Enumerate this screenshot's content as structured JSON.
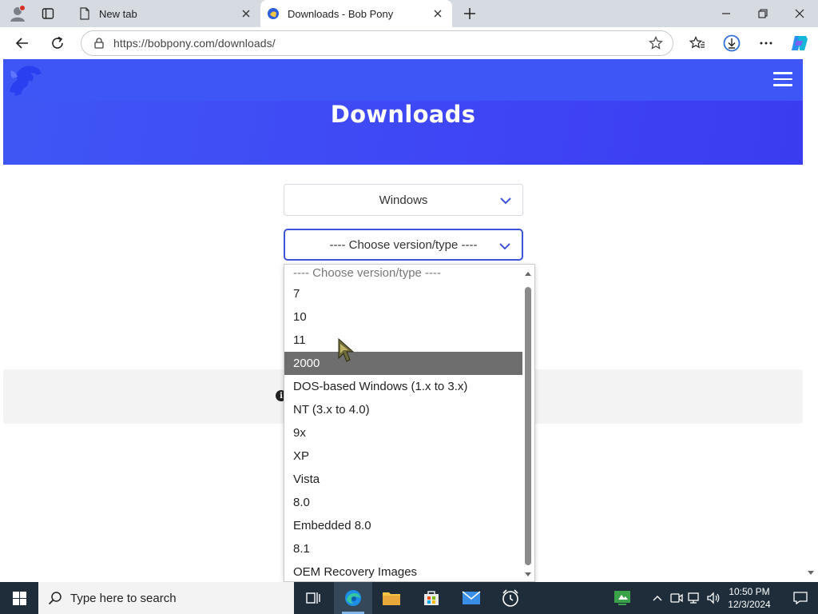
{
  "browser": {
    "tabs": [
      {
        "label": "New tab"
      },
      {
        "label": "Downloads - Bob Pony"
      }
    ],
    "url": "https://bobpony.com/downloads/"
  },
  "page": {
    "title": "Downloads",
    "os_select": {
      "value": "Windows"
    },
    "version_select": {
      "value": "---- Choose version/type ----"
    },
    "info_icon_glyph": "i"
  },
  "dropdown": {
    "options": [
      "---- Choose version/type ----",
      "7",
      "10",
      "11",
      "2000",
      "DOS-based Windows (1.x to 3.x)",
      "NT (3.x to 4.0)",
      "9x",
      "XP",
      "Vista",
      "8.0",
      "Embedded 8.0",
      "8.1",
      "OEM Recovery Images"
    ],
    "highlighted": "2000"
  },
  "taskbar": {
    "search_placeholder": "Type here to search",
    "time": "10:50 PM",
    "date": "12/3/2024"
  },
  "colors": {
    "hero": "#3f4ff5",
    "accent_border": "#3d53d8",
    "highlight": "#6e6e6e",
    "taskbar": "#1f2d3a"
  }
}
